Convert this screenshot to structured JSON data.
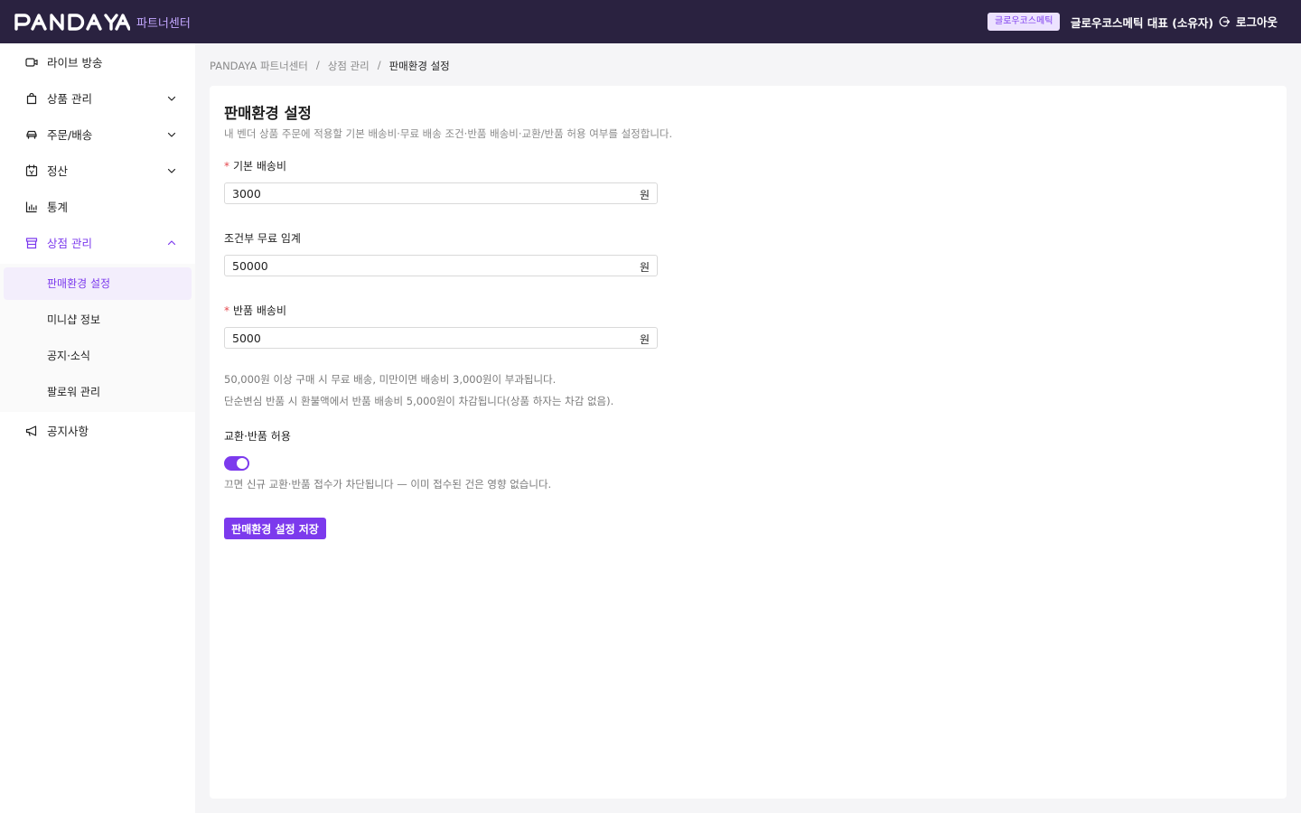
{
  "header": {
    "logo_text": "PANDAYA",
    "partner_label": "파트너센터",
    "store_badge": "글로우코스메틱",
    "user_name": "글로우코스메틱 대표 (소유자)",
    "logout_label": "로그아웃",
    "background": "#2a2240",
    "accent": "#7c3aed"
  },
  "sidebar": {
    "items": [
      {
        "label": "라이브 방송",
        "icon": "video-icon"
      },
      {
        "label": "상품 관리",
        "icon": "shopping-bag-icon",
        "expandable": true
      },
      {
        "label": "주문/배송",
        "icon": "car-icon",
        "expandable": true
      },
      {
        "label": "정산",
        "icon": "calendar-icon",
        "expandable": true
      },
      {
        "label": "통계",
        "icon": "bar-chart-icon"
      },
      {
        "label": "상점 관리",
        "icon": "store-icon",
        "expandable": true,
        "expanded": true
      },
      {
        "label": "공지사항",
        "icon": "megaphone-icon"
      }
    ],
    "submenu": [
      {
        "label": "판매환경 설정",
        "selected": true
      },
      {
        "label": "미니샵 정보"
      },
      {
        "label": "공지·소식"
      },
      {
        "label": "팔로워 관리"
      }
    ]
  },
  "breadcrumb": {
    "items": [
      "PANDAYA 파트너센터",
      "상점 관리",
      "판매환경 설정"
    ],
    "separator": "/"
  },
  "form": {
    "title": "판매환경 설정",
    "description": "내 벤더 상품 주문에 적용할 기본 배송비·무료 배송 조건·반품 배송비·교환/반품 허용 여부를 설정합니다.",
    "fields": [
      {
        "label": "기본 배송비",
        "required": true,
        "value": "3000",
        "unit": "원"
      },
      {
        "label": "조건부 무료 임계",
        "required": false,
        "value": "50000",
        "unit": "원"
      },
      {
        "label": "반품 배송비",
        "required": true,
        "value": "5000",
        "unit": "원"
      }
    ],
    "info_lines": [
      "50,000원 이상 구매 시 무료 배송, 미만이면 배송비 3,000원이 부과됩니다.",
      "단순변심 반품 시 환불액에서 반품 배송비 5,000원이 차감됩니다(상품 하자는 차감 없음)."
    ],
    "exchange_return": {
      "label": "교환·반품 허용",
      "enabled": true,
      "help": "끄면 신규 교환·반품 접수가 차단됩니다 — 이미 접수된 건은 영향 없습니다."
    },
    "save_label": "판매환경 설정 저장"
  }
}
